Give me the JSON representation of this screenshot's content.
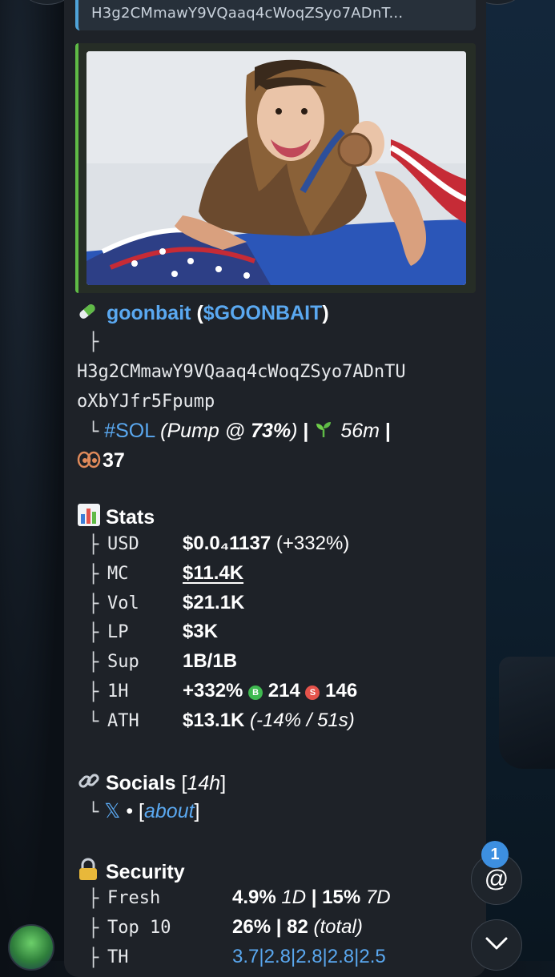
{
  "reply": {
    "text": "H3g2CMmawY9VQaaq4cWoqZSyo7ADnT..."
  },
  "token": {
    "icon": "pill-icon",
    "name": "goonbait",
    "open_paren": "(",
    "ticker": "$GOONBAIT",
    "close_paren": ")",
    "tree_1": "├",
    "address_line1": "H3g2CMmawY9VQaaq4cWoqZSyo7ADnTU",
    "address_line2": "oXbYJfr5Fpump",
    "tree_2": "└",
    "chain": "#SOL",
    "pump_open": "(Pump @ ",
    "pump_pct": "73%",
    "pump_close": ")",
    "sep": "|",
    "age_icon": "seedling-icon",
    "age": "56m",
    "sep2": "|",
    "holders_icon": "eyes-icon",
    "holders": "37"
  },
  "stats": {
    "icon": "bar-chart-icon",
    "title": "Stats",
    "rows": [
      {
        "tree": "├",
        "key": "USD",
        "value": "$0.0₄1137",
        "extra": " (+332%)"
      },
      {
        "tree": "├",
        "key": "MC",
        "value": "$11.4K",
        "extra": ""
      },
      {
        "tree": "├",
        "key": "Vol",
        "value": "$21.1K",
        "extra": ""
      },
      {
        "tree": "├",
        "key": "LP",
        "value": "$3K",
        "extra": ""
      },
      {
        "tree": "├",
        "key": "Sup",
        "value": "1B/1B",
        "extra": ""
      },
      {
        "tree": "├",
        "key": "1H",
        "value": "+332%",
        "extra": ""
      },
      {
        "tree": "└",
        "key": "ATH",
        "value": "$13.1K",
        "extra": " (-14% / 51s)"
      }
    ],
    "buys_label": "B",
    "buys": "214",
    "sells_label": "S",
    "sells": "146"
  },
  "socials": {
    "icon": "link-icon",
    "title": "Socials",
    "age_open": " [",
    "age": "14h",
    "age_close": "]",
    "tree": "└",
    "x_icon": "𝕏",
    "dot": "•",
    "about_open": "[",
    "about": "about",
    "about_close": "]"
  },
  "security": {
    "icon": "lock-icon",
    "title": "Security",
    "rows": [
      {
        "tree": "├",
        "key": "Fresh",
        "v1": "4.9%",
        "s1": " 1D",
        "sep": " | ",
        "v2": "15%",
        "s2": " 7D"
      },
      {
        "tree": "├",
        "key": "Top 10",
        "v1": "26%",
        "s1": "",
        "sep": " | ",
        "v2": "82",
        "s2": " (total)"
      },
      {
        "tree": "├",
        "key": "TH",
        "v1": "3.7|2.8|2.8|2.8|2.5",
        "s1": "",
        "sep": "",
        "v2": "",
        "s2": ""
      }
    ]
  },
  "ui": {
    "mentions_badge": "1",
    "mention_symbol": "@",
    "scroll_down_icon": "chevron-down-icon",
    "avatar_label": "sender-avatar"
  },
  "colors": {
    "accent_link": "#5aa8f0",
    "bubble": "#1e2228",
    "buy": "#3fb950",
    "sell": "#e5534b",
    "badge": "#3d8fe0"
  }
}
